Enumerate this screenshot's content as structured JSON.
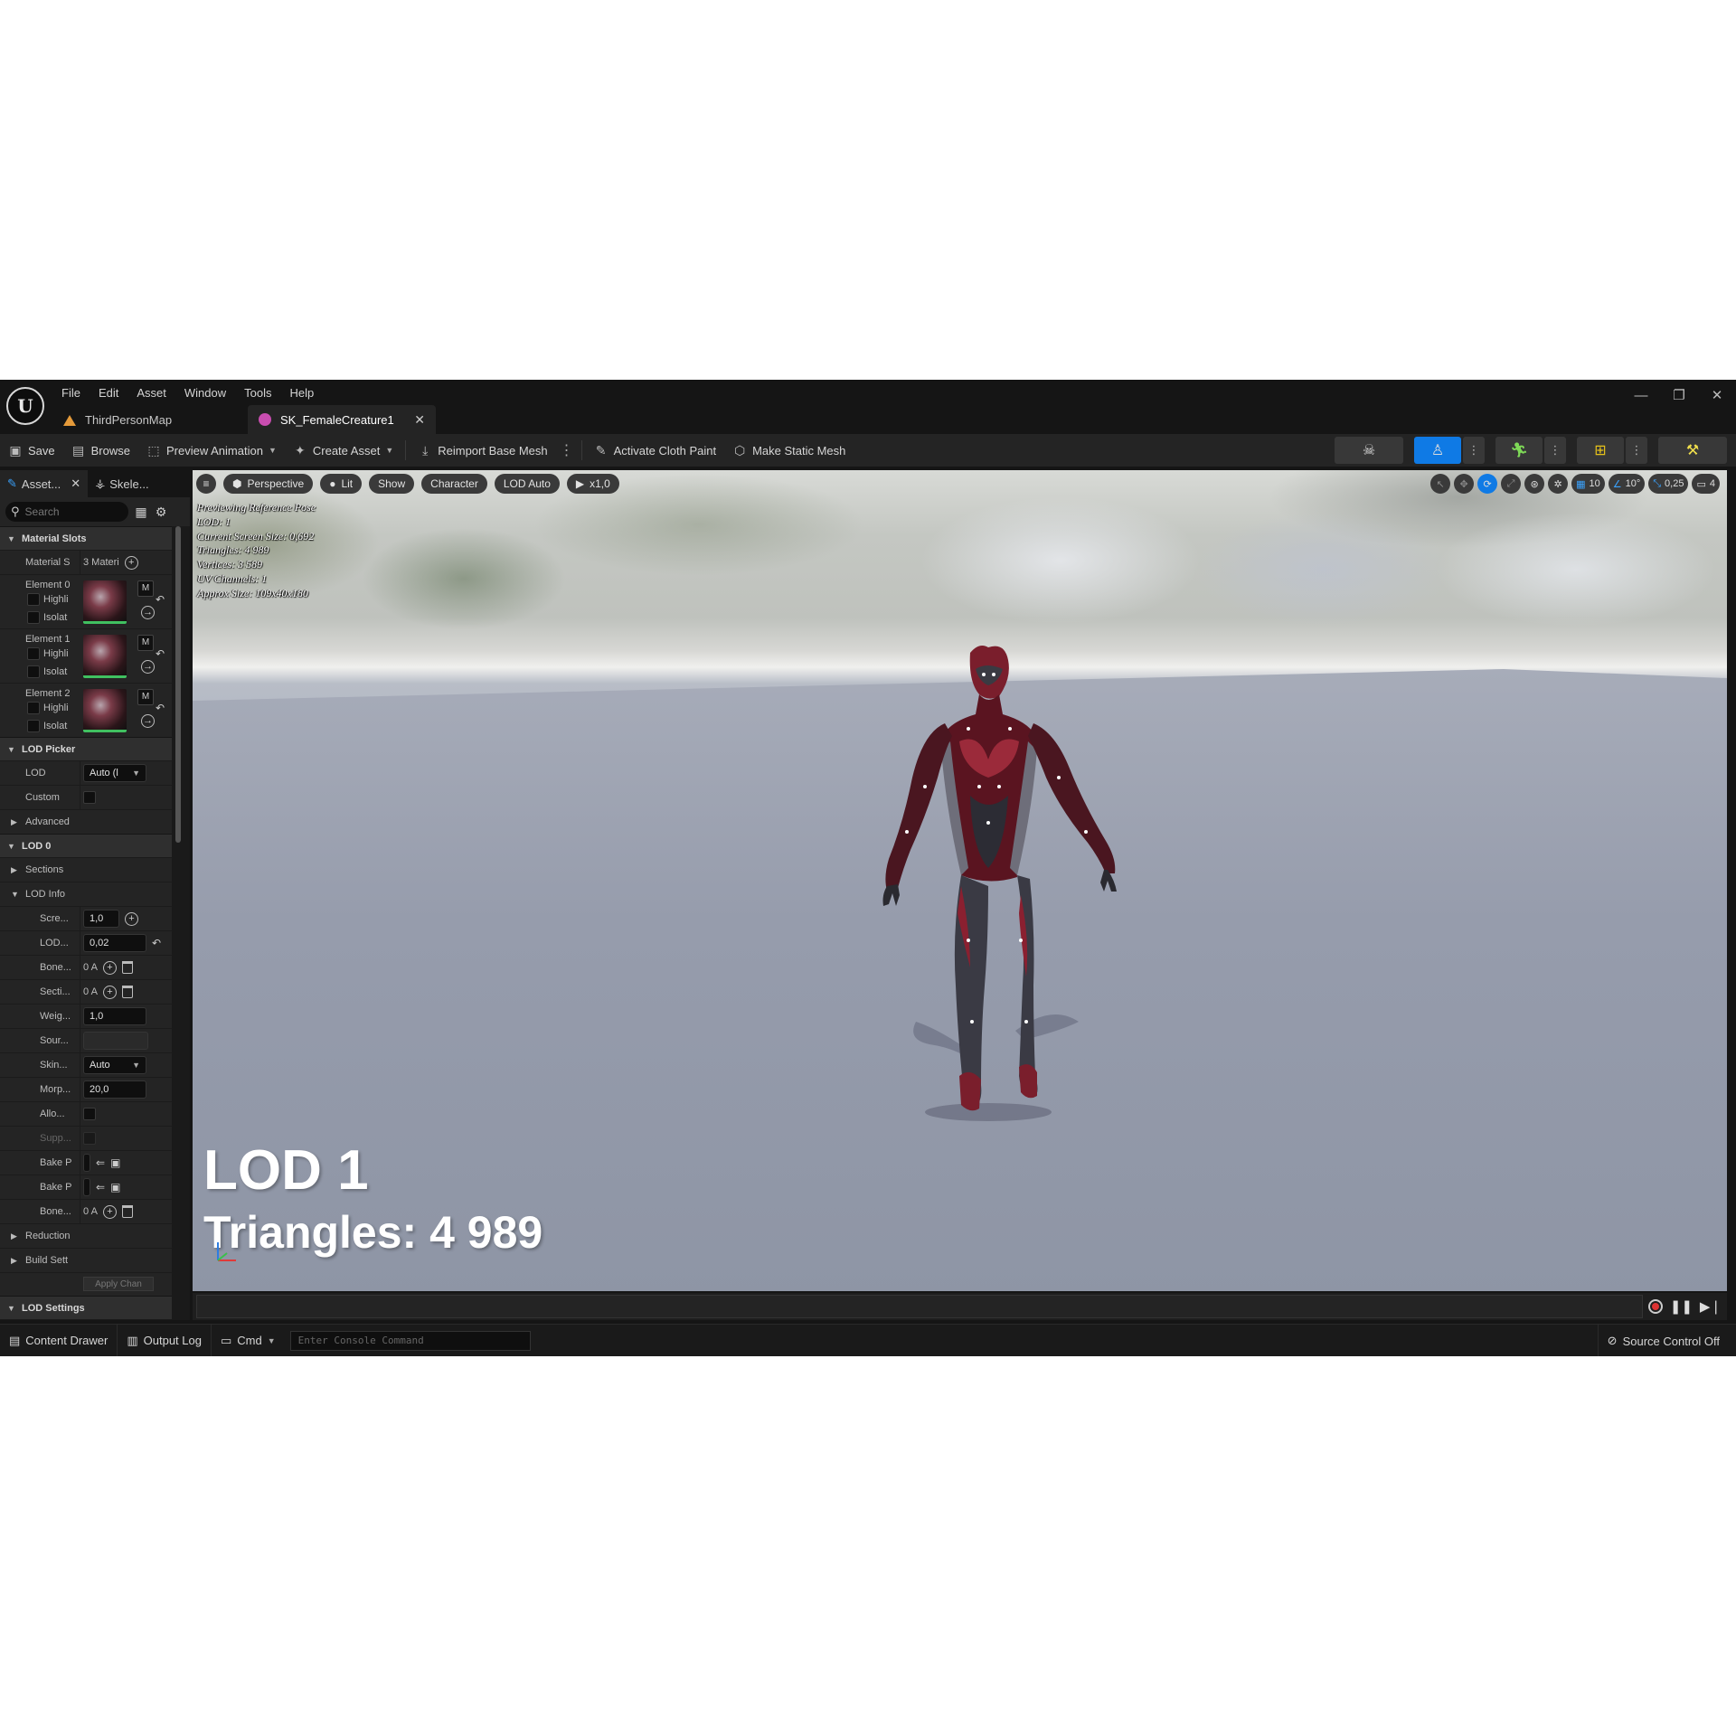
{
  "menu": [
    "File",
    "Edit",
    "Asset",
    "Window",
    "Tools",
    "Help"
  ],
  "tabs": [
    {
      "label": "ThirdPersonMap",
      "active": false
    },
    {
      "label": "SK_FemaleCreature1",
      "active": true
    }
  ],
  "toolbar": {
    "save": "Save",
    "browse": "Browse",
    "preview_animation": "Preview Animation",
    "create_asset": "Create Asset",
    "reimport_base_mesh": "Reimport Base Mesh",
    "activate_cloth_paint": "Activate Cloth Paint",
    "make_static_mesh": "Make Static Mesh"
  },
  "left_panel": {
    "tabs": [
      "Asset...",
      "Skele..."
    ],
    "search_placeholder": "Search",
    "material_slots": {
      "header": "Material Slots",
      "label": "Material S",
      "value": "3 Materi",
      "elements": [
        {
          "name": "Element 0",
          "highlight": "Highli",
          "isolate": "Isolat"
        },
        {
          "name": "Element 1",
          "highlight": "Highli",
          "isolate": "Isolat"
        },
        {
          "name": "Element 2",
          "highlight": "Highli",
          "isolate": "Isolat"
        }
      ],
      "material_button": "M"
    },
    "lod_picker": {
      "header": "LOD Picker",
      "lod_label": "LOD",
      "lod_value": "Auto (l",
      "custom_label": "Custom",
      "advanced_label": "Advanced"
    },
    "lod0": {
      "header": "LOD 0",
      "sections_label": "Sections",
      "lod_info_label": "LOD Info",
      "rows": [
        {
          "label": "Scre...",
          "value": "1,0"
        },
        {
          "label": "LOD...",
          "value": "0,02"
        },
        {
          "label": "Bone...",
          "value": "0 A"
        },
        {
          "label": "Secti...",
          "value": "0 A"
        },
        {
          "label": "Weig...",
          "value": "1,0"
        },
        {
          "label": "Sour...",
          "value": ""
        },
        {
          "label": "Skin...",
          "value": "Auto"
        },
        {
          "label": "Morp...",
          "value": "20,0"
        },
        {
          "label": "Allo...",
          "value": ""
        },
        {
          "label": "Supp...",
          "value": ""
        },
        {
          "label": "Bake P",
          "value": ""
        },
        {
          "label": "Bake P",
          "value": ""
        },
        {
          "label": "Bone...",
          "value": "0 A"
        }
      ],
      "reduction_label": "Reduction",
      "build_settings_label": "Build Sett",
      "apply_changes": "Apply Chan"
    },
    "lod_settings_header": "LOD Settings"
  },
  "viewport": {
    "perspective": "Perspective",
    "lit": "Lit",
    "show": "Show",
    "character": "Character",
    "lod_auto": "LOD Auto",
    "play_speed": "x1,0",
    "grid_snap": "10",
    "rotation_snap": "10°",
    "scale_snap": "0,25",
    "camera_speed": "4",
    "stats": [
      "Previewing Reference Pose",
      "LOD: 1",
      "Current Screen Size: 0,692",
      "Triangles: 4 989",
      "Vertices: 3 589",
      "UV Channels: 1",
      "Approx Size: 109x40x180"
    ],
    "overlay_lod": "LOD 1",
    "overlay_triangles": "Triangles: 4 989"
  },
  "statusbar": {
    "content_drawer": "Content Drawer",
    "output_log": "Output Log",
    "cmd": "Cmd",
    "console_placeholder": "Enter Console Command",
    "source_control": "Source Control Off"
  },
  "colors": {
    "accent_blue": "#0f7ae5",
    "panel_bg": "#242424",
    "frame_bg": "#151515"
  }
}
